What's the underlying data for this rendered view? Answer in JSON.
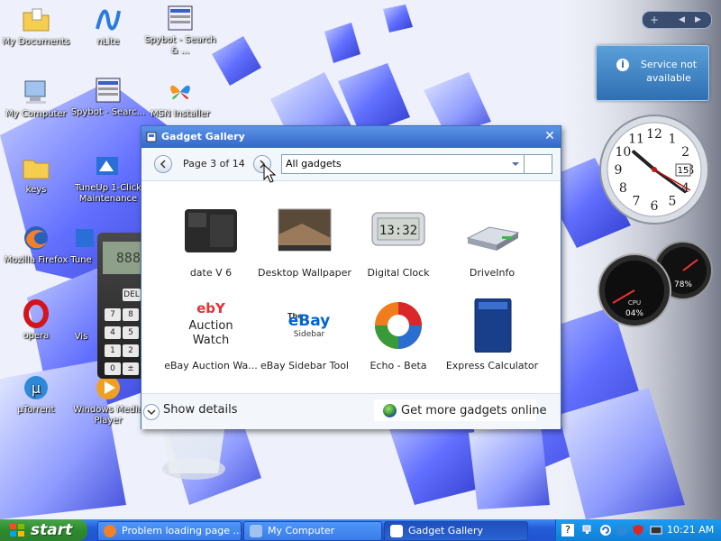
{
  "desktop": {
    "icons": [
      {
        "label": "My Documents"
      },
      {
        "label": "nLite"
      },
      {
        "label": "Spybot - Search & ..."
      },
      {
        "label": "My Computer"
      },
      {
        "label": "Spybot - Searc..."
      },
      {
        "label": "MSN Installer"
      },
      {
        "label": "keys"
      },
      {
        "label": "TuneUp 1-Click Maintenance"
      },
      {
        "label": "Mozilla Firefox"
      },
      {
        "label": "Tune"
      },
      {
        "label": "opera"
      },
      {
        "label": "Vis"
      },
      {
        "label": "µTorrent"
      },
      {
        "label": "Windows Media Player"
      }
    ]
  },
  "sidebar": {
    "controls": [
      "+",
      "◀",
      "▶"
    ],
    "service_text": "Service not available",
    "clock": {
      "hour": 10,
      "minute": 21,
      "second": 20,
      "date": "15",
      "numerals": [
        "12",
        "1",
        "2",
        "3",
        "4",
        "5",
        "6",
        "7",
        "8",
        "9",
        "10",
        "11"
      ]
    },
    "cpu": {
      "cpu_label": "CPU",
      "cpu_value": "04%",
      "mem_value": "78%"
    }
  },
  "calculator": {
    "display": "888",
    "keys": [
      "DEL",
      "7",
      "8",
      "4",
      "5",
      "1",
      "2",
      "0",
      "±"
    ]
  },
  "gallery": {
    "title": "Gadget Gallery",
    "page_info": "Page 3 of 14",
    "filter": "All gadgets",
    "gadgets": [
      {
        "label": "date V 6"
      },
      {
        "label": "Desktop Wallpaper"
      },
      {
        "label": "Digital Clock",
        "thumb_text": "13:32"
      },
      {
        "label": "DriveInfo"
      },
      {
        "label": "eBay Auction Wa...",
        "thumb_lines": [
          "ebY",
          "Auction",
          "Watch"
        ]
      },
      {
        "label": "eBay Sidebar Tool",
        "thumb_lines": [
          "The",
          "eBay",
          "Sidebar"
        ]
      },
      {
        "label": "Echo - Beta"
      },
      {
        "label": "Express Calculator"
      }
    ],
    "show_details": "Show details",
    "get_more": "Get more gadgets online"
  },
  "taskbar": {
    "start": "start",
    "tasks": [
      {
        "label": "Problem loading page ..."
      },
      {
        "label": "My Computer"
      },
      {
        "label": "Gadget Gallery"
      }
    ],
    "clock": "10:21 AM"
  }
}
